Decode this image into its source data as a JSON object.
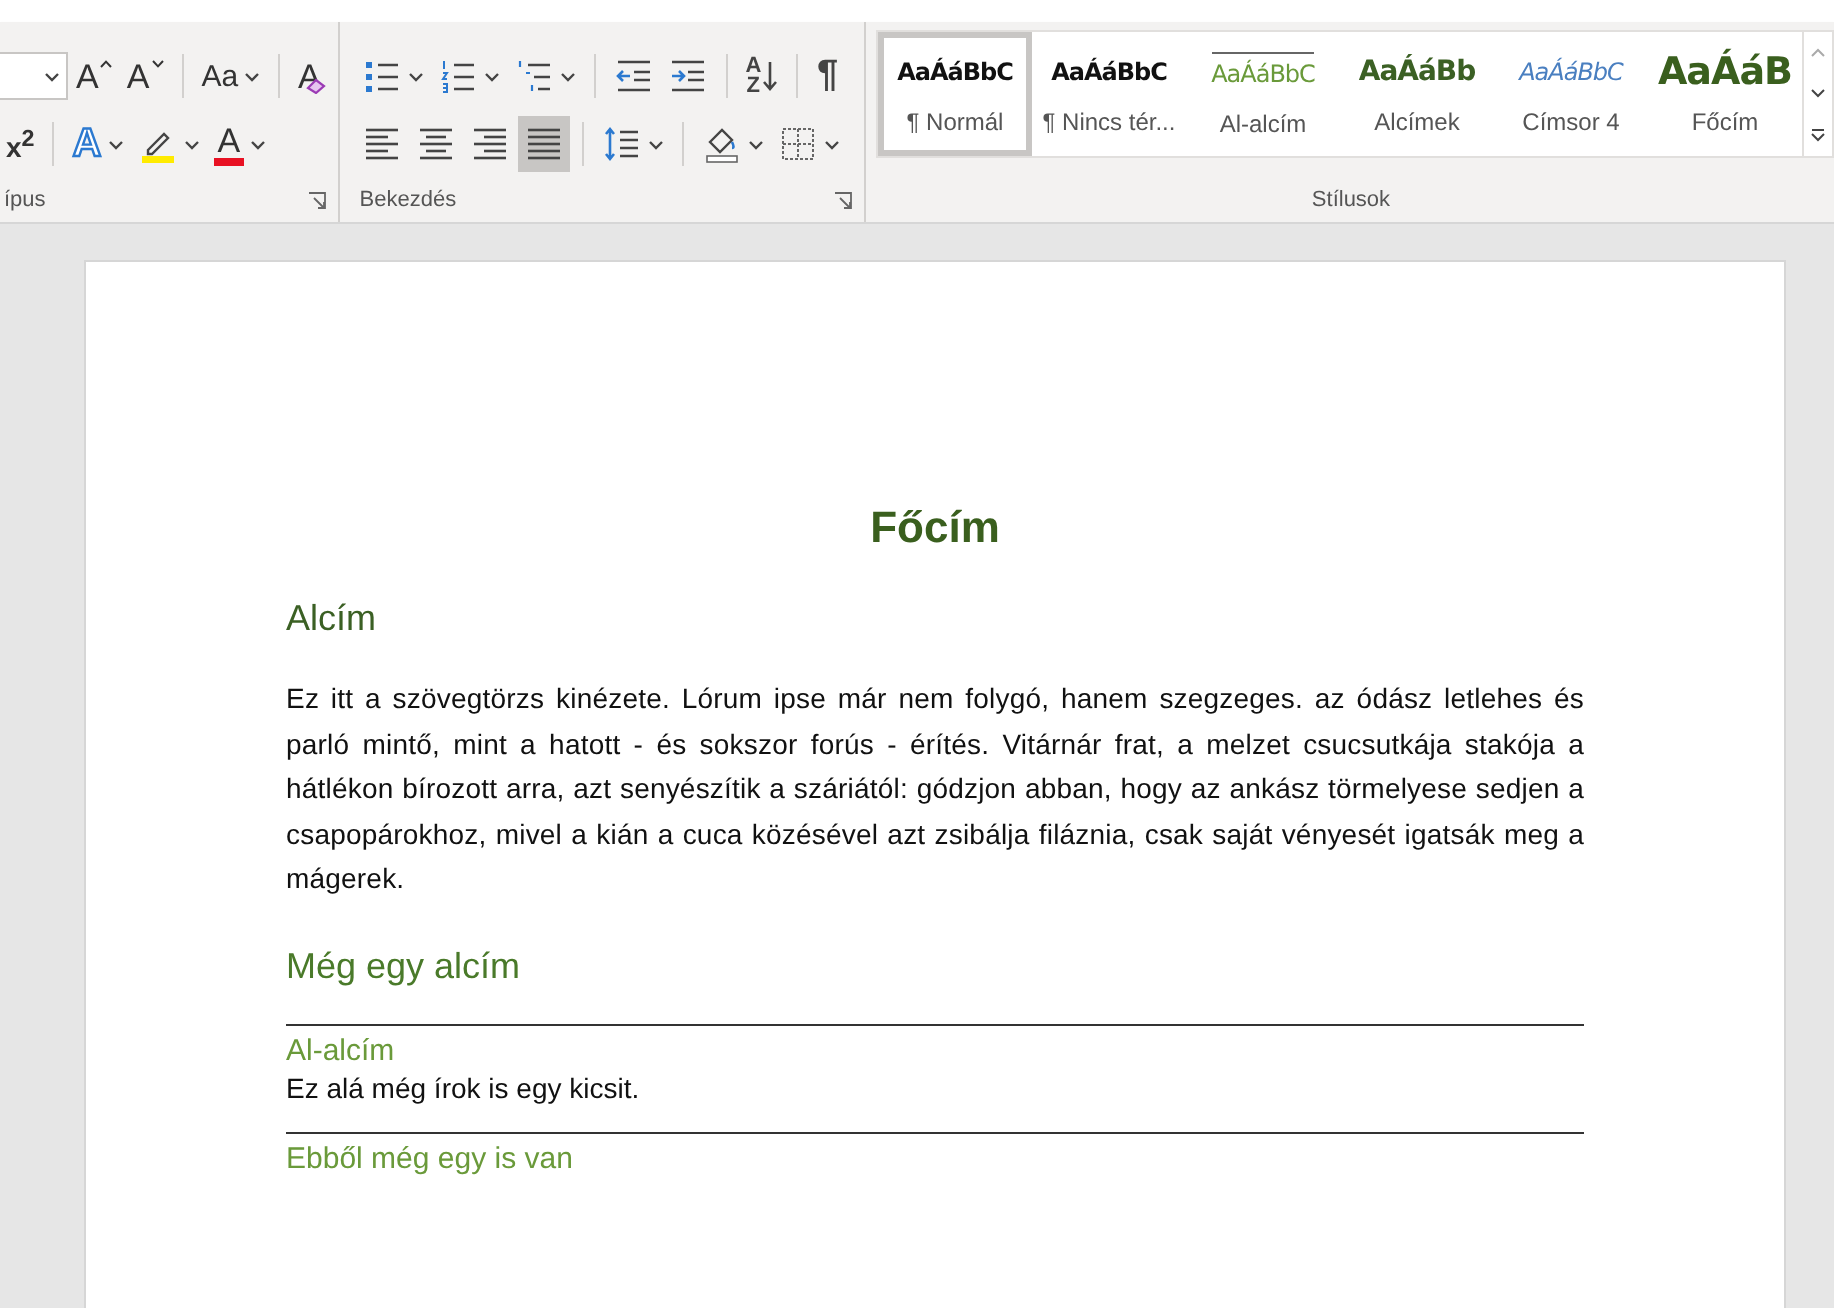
{
  "ribbon": {
    "groups": [
      {
        "label": "ípus",
        "launcher": true,
        "rows": [
          {
            "tools": [
              {
                "kind": "field",
                "dropdown": true
              },
              {
                "kind": "grow",
                "label": "A"
              },
              {
                "kind": "shrink",
                "label": "A"
              },
              {
                "kind": "sep"
              },
              {
                "kind": "case",
                "label": "Aa",
                "dropdown": true
              },
              {
                "kind": "sep"
              },
              {
                "kind": "clear",
                "label": "A"
              }
            ]
          },
          {
            "tools": [
              {
                "kind": "superscript",
                "label": "x$^{2}$"
              },
              {
                "kind": "sep"
              },
              {
                "kind": "effects",
                "label": "A",
                "dropdown": true
              },
              {
                "kind": "highlight",
                "dropdown": true
              },
              {
                "kind": "fontcolor",
                "label": "A",
                "dropdown": true
              }
            ]
          }
        ]
      },
      {
        "label": "Bekezdés",
        "launcher": true,
        "rows": [
          {
            "tools": [
              {
                "kind": "bullets",
                "dropdown": true
              },
              {
                "kind": "numbering",
                "dropdown": true
              },
              {
                "kind": "multilevel",
                "dropdown": true
              },
              {
                "kind": "sep"
              },
              {
                "kind": "outdent"
              },
              {
                "kind": "indent"
              },
              {
                "kind": "sep"
              },
              {
                "kind": "sort",
                "label": "AZ"
              },
              {
                "kind": "sep"
              },
              {
                "kind": "pilcrow",
                "label": "¶"
              }
            ]
          },
          {
            "tools": [
              {
                "kind": "align-left",
                "selected": false
              },
              {
                "kind": "align-center",
                "selected": false
              },
              {
                "kind": "align-right",
                "selected": false
              },
              {
                "kind": "justify",
                "selected": true
              },
              {
                "kind": "sep"
              },
              {
                "kind": "spacing",
                "dropdown": true
              },
              {
                "kind": "sep"
              },
              {
                "kind": "shading",
                "dropdown": true
              },
              {
                "kind": "borders",
                "dropdown": true
              }
            ]
          }
        ]
      }
    ],
    "styles": {
      "label": "Stílusok",
      "items": [
        {
          "kind": "normal",
          "preview": "AaÁáBbC",
          "name": "¶ Normál",
          "selected": true
        },
        {
          "kind": "nospace",
          "preview": "AaÁáBbC",
          "name": "¶ Nincs tér...",
          "selected": false
        },
        {
          "kind": "subsub",
          "preview": "AaÁáBbC",
          "name": "Al-alcím",
          "selected": false
        },
        {
          "kind": "sub",
          "preview": "AaÁáBb",
          "name": "Alcímek",
          "selected": false
        },
        {
          "kind": "h4",
          "preview": "AaÁáBbC",
          "name": "Címsor 4",
          "selected": false
        },
        {
          "kind": "title",
          "preview": "AaÁáB",
          "name": "Főcím",
          "selected": false
        }
      ]
    }
  },
  "document": {
    "blocks": [
      {
        "kind": "title",
        "text": "Főcím"
      },
      {
        "kind": "heading",
        "text": "Alcím"
      },
      {
        "kind": "body",
        "text": "Ez itt a szövegtörzs kinézete. Lórum ipse már nem folygó, hanem szegzeges. az ódász letlehes és parló mintő, mint a hatott - és sokszor forús - érítés. Vitárnár frat, a melzet csucsutkája stakója a hátlékon bírozott arra, azt senyészítik a száriától: gódzjon abban, hogy az ankász törmelyese sedjen a csapopárokhoz, mivel a kián a cuca közésével azt zsibálja filáznia, csak saját vényesét igatsák meg a mágerek."
      },
      {
        "kind": "heading2",
        "text": "Még egy alcím"
      },
      {
        "kind": "subheading",
        "text": "Al-alcím",
        "rule_above": true
      },
      {
        "kind": "body2",
        "text": "Ez alá még írok is egy kicsit."
      },
      {
        "kind": "subheading",
        "text": "Ebből még egy is van",
        "rule_above": true
      }
    ]
  }
}
